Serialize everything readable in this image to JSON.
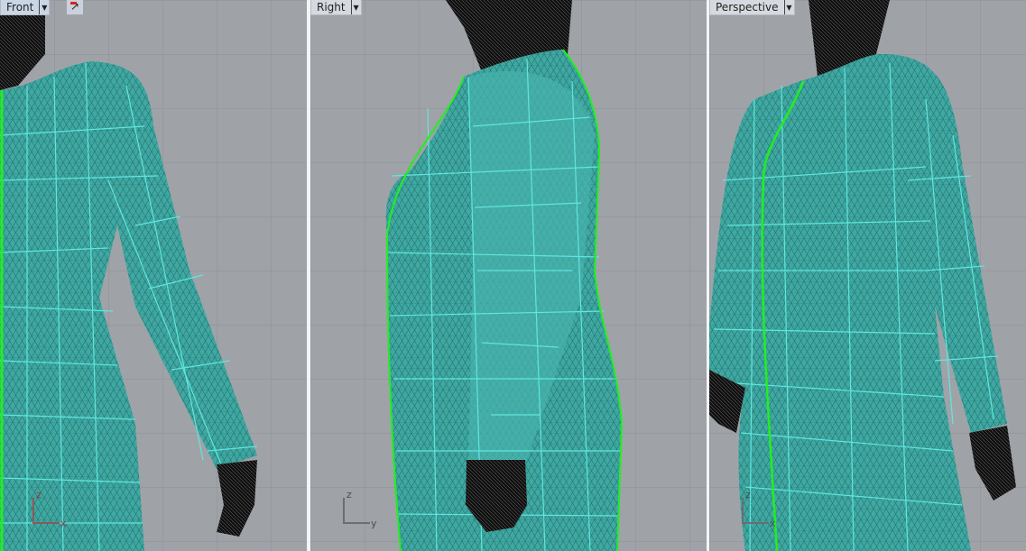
{
  "viewports": [
    {
      "name": "Front",
      "active": true,
      "axes": [
        "z",
        "x"
      ]
    },
    {
      "name": "Right",
      "active": false,
      "axes": [
        "z",
        "y"
      ]
    },
    {
      "name": "Perspective",
      "active": false,
      "axes": [
        "z",
        "x"
      ]
    }
  ],
  "colors": {
    "background": "#9fa3a8",
    "surface": "#3fa8a2",
    "isocurve": "#5fe6e0",
    "seam": "#22ee22",
    "mesh": "#111111"
  },
  "icons": {
    "dropdown": "triangle-down",
    "gumball": "gumball-icon"
  }
}
